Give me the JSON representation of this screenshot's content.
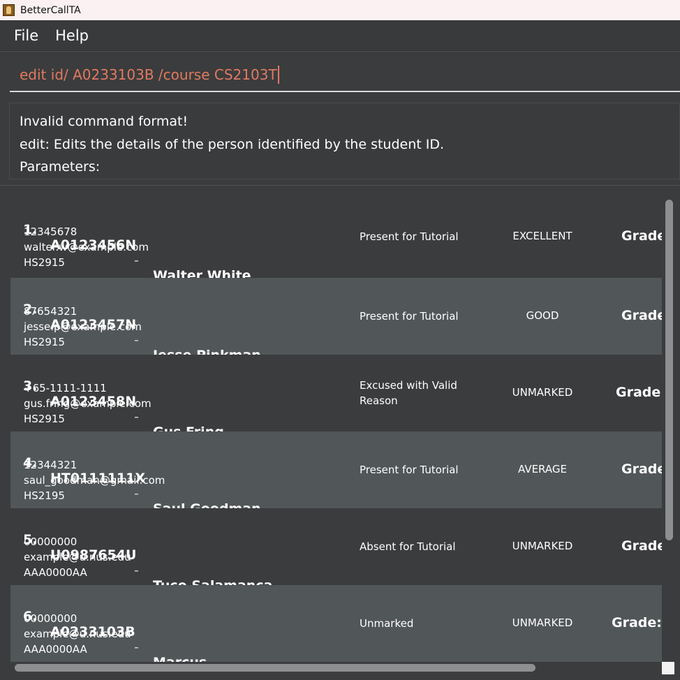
{
  "window": {
    "title": "BetterCallTA"
  },
  "menu": {
    "file": "File",
    "help": "Help"
  },
  "command": {
    "value": "edit id/ A0233103B /course CS2103T"
  },
  "result": {
    "line1": "Invalid command format!",
    "line2": "edit: Edits the details of the person identified by the student ID.",
    "line3": "Parameters:"
  },
  "students": [
    {
      "index": "1.",
      "id": "A0123456N",
      "dash": "-",
      "name": "Walter White",
      "phone": "12345678",
      "email": "walter.w@example.com",
      "course": "HS2915",
      "attendance": "Present for Tutorial",
      "participation": "EXCELLENT",
      "grade": "Grade:"
    },
    {
      "index": "2.",
      "id": "A0123457N",
      "dash": "-",
      "name": "Jesse Pinkman",
      "phone": "87654321",
      "email": "jesse.p@example.com",
      "course": "HS2915",
      "attendance": "Present for Tutorial",
      "participation": "GOOD",
      "grade": "Grade:"
    },
    {
      "index": "3.",
      "id": "A0123458N",
      "dash": "-",
      "name": "Gus Fring",
      "phone": "+65-1111-1111",
      "email": "gus.fring@example.com",
      "course": "HS2915",
      "attendance": "Excused with Valid Reason",
      "participation": "UNMARKED",
      "grade": "Grade: '"
    },
    {
      "index": "4.",
      "id": "HT0111111X",
      "dash": "-",
      "name": "Saul Goodman",
      "phone": "12344321",
      "email": "saul_goodman@gmail.com",
      "course": "HS2195",
      "attendance": "Present for Tutorial",
      "participation": "AVERAGE",
      "grade": "Grade:"
    },
    {
      "index": "5.",
      "id": "U0987654U",
      "dash": "-",
      "name": "Tuco Salamanca",
      "phone": "00000000",
      "email": "example@u.nus.edu",
      "course": "AAA0000AA",
      "attendance": "Absent for Tutorial",
      "participation": "UNMARKED",
      "grade": "Grade:"
    },
    {
      "index": "6.",
      "id": "A0233103B",
      "dash": "-",
      "name": "Marcus",
      "phone": "00000000",
      "email": "example@u.nus.edu",
      "course": "AAA0000AA",
      "attendance": "Unmarked",
      "participation": "UNMARKED",
      "grade": "Grade: N"
    }
  ]
}
